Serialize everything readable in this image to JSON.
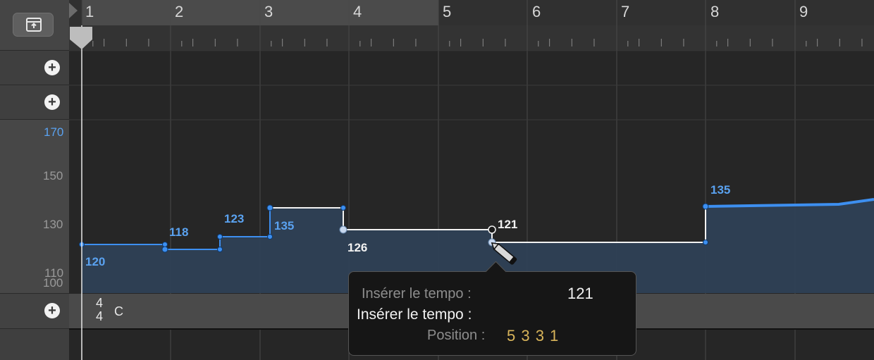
{
  "bars": [
    "1",
    "2",
    "3",
    "4",
    "5",
    "6",
    "7",
    "8",
    "9"
  ],
  "y_labels": {
    "l170": "170",
    "l150": "150",
    "l130": "130",
    "l110": "110",
    "l100": "100"
  },
  "tempo_labels": {
    "t120": "120",
    "t118": "118",
    "t123": "123",
    "t135a": "135",
    "t126": "126",
    "t121": "121",
    "t135b": "135"
  },
  "signature": {
    "num": "4",
    "den": "4",
    "key": "C"
  },
  "tooltip": {
    "row1_label": "Insérer le tempo :",
    "row1_value": "121",
    "row2_label": "Insérer le tempo :",
    "row3_label": "Position :",
    "row3_value": "5 3 3 1"
  },
  "add_buttons": {
    "plus1": "+",
    "plus2": "+",
    "plus3": "+"
  },
  "colors": {
    "tempo_blue": "#3d8ff0",
    "fill": "#2e4055",
    "position_gold": "#d8b45a",
    "label_blue": "#5aa2f0"
  },
  "icons": {
    "track_view": "window-upload-icon",
    "add": "plus-circle-icon",
    "pencil": "pencil-icon",
    "playhead": "playhead-icon"
  }
}
